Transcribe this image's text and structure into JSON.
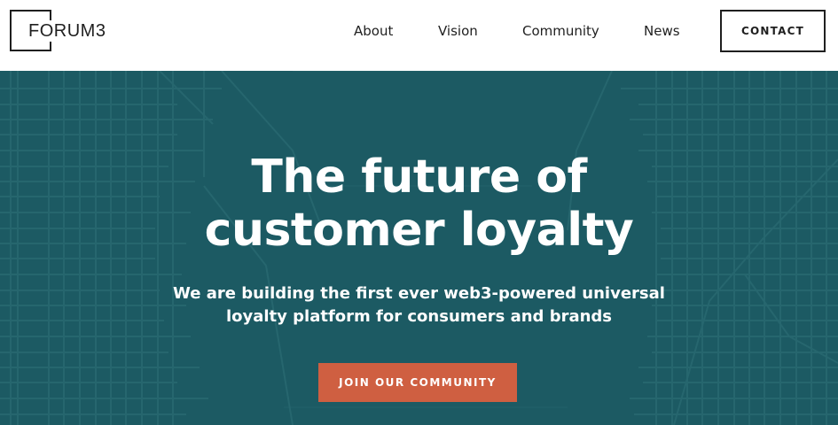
{
  "header": {
    "logo_text": "FORUM3",
    "nav": [
      {
        "label": "About"
      },
      {
        "label": "Vision"
      },
      {
        "label": "Community"
      },
      {
        "label": "News"
      }
    ],
    "contact_label": "CONTACT"
  },
  "hero": {
    "title_line1": "The future of",
    "title_line2": "customer loyalty",
    "subtitle_line1": "We are building the first ever web3-powered universal",
    "subtitle_line2": "loyalty platform for consumers and brands",
    "cta_label": "JOIN OUR COMMUNITY"
  },
  "colors": {
    "hero_background": "#1c5a63",
    "map_lines": "#2a6a72",
    "cta_background": "#cf5f41",
    "text_dark": "#1f1f1f",
    "text_light": "#ffffff"
  },
  "icons": {
    "hero_background": "city-map-pattern"
  }
}
